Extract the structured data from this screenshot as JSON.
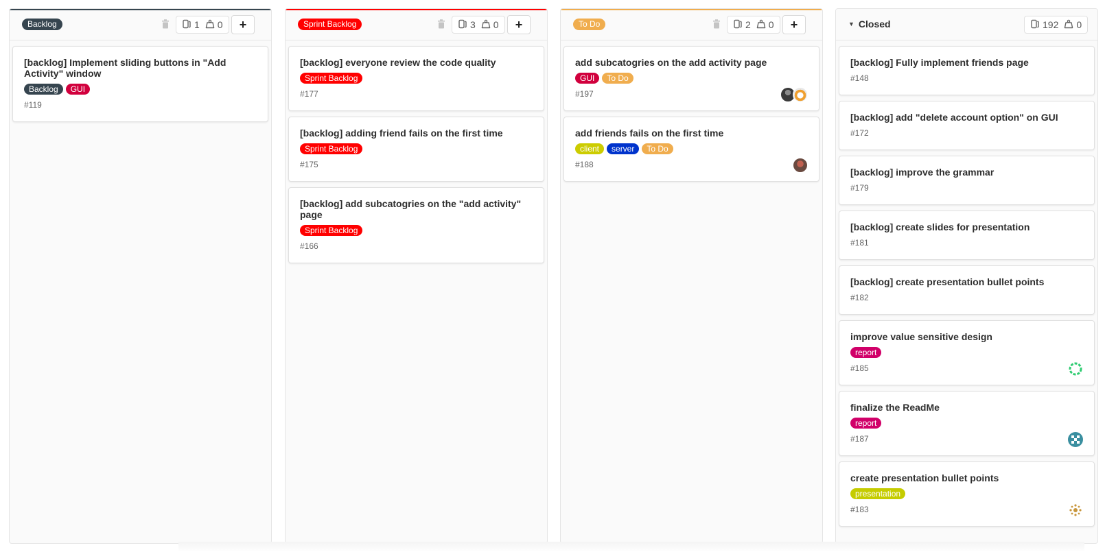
{
  "colors": {
    "backlog": "#36454f",
    "sprint_backlog": "#ff0000",
    "to_do": "#f0ad4e",
    "gui": "#d1003d",
    "client": "#cccc00",
    "server": "#0033cc",
    "report": "#d10069",
    "presentation": "#c5cc00"
  },
  "columns": [
    {
      "label": "Backlog",
      "issue_count": "1",
      "weight": "0",
      "cards": [
        {
          "title": "[backlog] Implement sliding buttons in \"Add Activity\" window",
          "labels": [
            "Backlog",
            "GUI"
          ],
          "number": "#119"
        }
      ]
    },
    {
      "label": "Sprint Backlog",
      "issue_count": "3",
      "weight": "0",
      "cards": [
        {
          "title": "[backlog] everyone review the code quality",
          "labels": [
            "Sprint Backlog"
          ],
          "number": "#177"
        },
        {
          "title": "[backlog] adding friend fails on the first time",
          "labels": [
            "Sprint Backlog"
          ],
          "number": "#175"
        },
        {
          "title": "[backlog] add subcatogries on the \"add activity\" page",
          "labels": [
            "Sprint Backlog"
          ],
          "number": "#166"
        }
      ]
    },
    {
      "label": "To Do",
      "issue_count": "2",
      "weight": "0",
      "cards": [
        {
          "title": "add subcatogries on the add activity page",
          "labels": [
            "GUI",
            "To Do"
          ],
          "number": "#197"
        },
        {
          "title": "add friends fails on the first time",
          "labels": [
            "client",
            "server",
            "To Do"
          ],
          "number": "#188"
        }
      ]
    },
    {
      "label": "Closed",
      "issue_count": "192",
      "weight": "0",
      "cards": [
        {
          "title": "[backlog] Fully implement friends page",
          "labels": [],
          "number": "#148"
        },
        {
          "title": "[backlog] add \"delete account option\" on GUI",
          "labels": [],
          "number": "#172"
        },
        {
          "title": "[backlog] improve the grammar",
          "labels": [],
          "number": "#179"
        },
        {
          "title": "[backlog] create slides for presentation",
          "labels": [],
          "number": "#181"
        },
        {
          "title": "[backlog] create presentation bullet points",
          "labels": [],
          "number": "#182"
        },
        {
          "title": "improve value sensitive design",
          "labels": [
            "report"
          ],
          "number": "#185"
        },
        {
          "title": "finalize the ReadMe",
          "labels": [
            "report"
          ],
          "number": "#187"
        },
        {
          "title": "create presentation bullet points",
          "labels": [
            "presentation"
          ],
          "number": "#183"
        }
      ]
    }
  ]
}
